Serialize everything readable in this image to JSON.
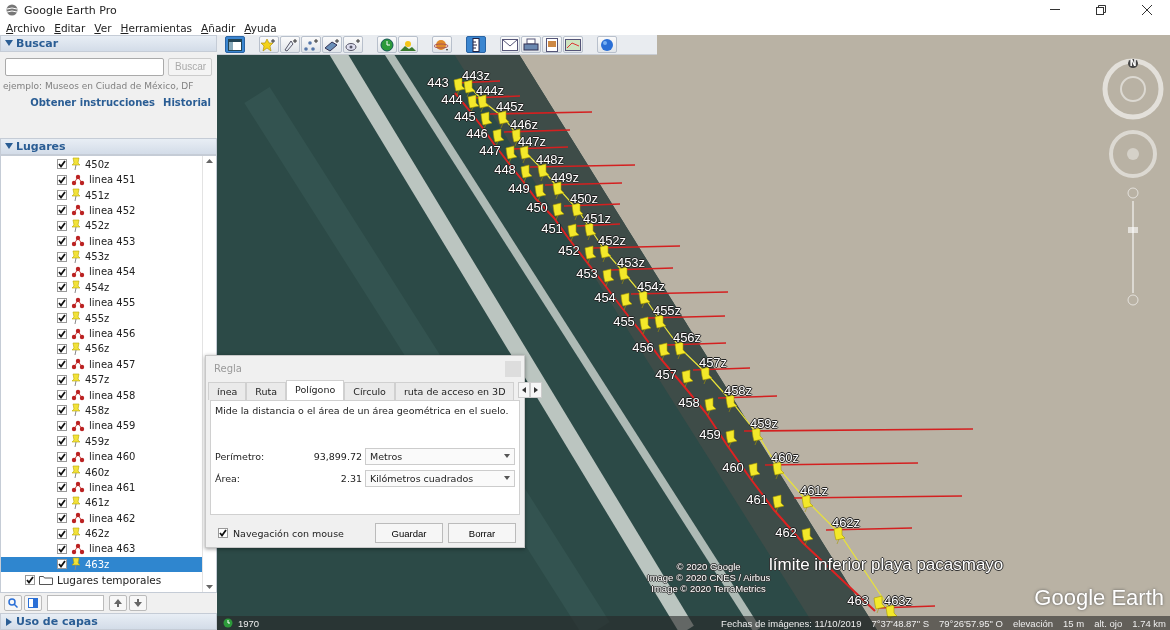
{
  "window": {
    "title": "Google Earth Pro"
  },
  "menu": [
    {
      "label": "Archivo"
    },
    {
      "label": "Editar"
    },
    {
      "label": "Ver"
    },
    {
      "label": "Herramientas"
    },
    {
      "label": "Añadir"
    },
    {
      "label": "Ayuda"
    }
  ],
  "search": {
    "title": "Buscar",
    "expanded": true,
    "button": "Buscar",
    "hint": "ejemplo: Museos en Ciudad de México, DF",
    "links": [
      "Obtener instrucciones",
      "Historial"
    ]
  },
  "places": {
    "title": "Lugares",
    "expanded": true,
    "items": [
      {
        "label": "450z",
        "kind": "placemark",
        "checked": true,
        "selected": false
      },
      {
        "label": "linea 451",
        "kind": "path",
        "checked": true,
        "selected": false
      },
      {
        "label": "451z",
        "kind": "placemark",
        "checked": true,
        "selected": false
      },
      {
        "label": "linea 452",
        "kind": "path",
        "checked": true,
        "selected": false
      },
      {
        "label": "452z",
        "kind": "placemark",
        "checked": true,
        "selected": false
      },
      {
        "label": "linea 453",
        "kind": "path",
        "checked": true,
        "selected": false
      },
      {
        "label": "453z",
        "kind": "placemark",
        "checked": true,
        "selected": false
      },
      {
        "label": "linea 454",
        "kind": "path",
        "checked": true,
        "selected": false
      },
      {
        "label": "454z",
        "kind": "placemark",
        "checked": true,
        "selected": false
      },
      {
        "label": "linea 455",
        "kind": "path",
        "checked": true,
        "selected": false
      },
      {
        "label": "455z",
        "kind": "placemark",
        "checked": true,
        "selected": false
      },
      {
        "label": "linea 456",
        "kind": "path",
        "checked": true,
        "selected": false
      },
      {
        "label": "456z",
        "kind": "placemark",
        "checked": true,
        "selected": false
      },
      {
        "label": "linea 457",
        "kind": "path",
        "checked": true,
        "selected": false
      },
      {
        "label": "457z",
        "kind": "placemark",
        "checked": true,
        "selected": false
      },
      {
        "label": "linea 458",
        "kind": "path",
        "checked": true,
        "selected": false
      },
      {
        "label": "458z",
        "kind": "placemark",
        "checked": true,
        "selected": false
      },
      {
        "label": "linea 459",
        "kind": "path",
        "checked": true,
        "selected": false
      },
      {
        "label": "459z",
        "kind": "placemark",
        "checked": true,
        "selected": false
      },
      {
        "label": "linea 460",
        "kind": "path",
        "checked": true,
        "selected": false
      },
      {
        "label": "460z",
        "kind": "placemark",
        "checked": true,
        "selected": false
      },
      {
        "label": "linea 461",
        "kind": "path",
        "checked": true,
        "selected": false
      },
      {
        "label": "461z",
        "kind": "placemark",
        "checked": true,
        "selected": false
      },
      {
        "label": "linea 462",
        "kind": "path",
        "checked": true,
        "selected": false
      },
      {
        "label": "462z",
        "kind": "placemark",
        "checked": true,
        "selected": false
      },
      {
        "label": "linea 463",
        "kind": "path",
        "checked": true,
        "selected": false
      },
      {
        "label": "463z",
        "kind": "placemark",
        "checked": true,
        "selected": true
      }
    ],
    "temporary": {
      "label": "Lugares temporales",
      "checked": true
    }
  },
  "layers": {
    "title": "Uso de capas",
    "expanded": false
  },
  "toolbar_groups": [
    {
      "items": [
        {
          "kind": "sidebar",
          "selected": true
        }
      ]
    },
    {
      "items": [
        {
          "kind": "placemark",
          "selected": false
        },
        {
          "kind": "polygon",
          "selected": false
        },
        {
          "kind": "path",
          "selected": false
        },
        {
          "kind": "overlay",
          "selected": false
        },
        {
          "kind": "tour",
          "selected": false
        }
      ]
    },
    {
      "items": [
        {
          "kind": "history",
          "selected": false
        },
        {
          "kind": "sun",
          "selected": false
        }
      ]
    },
    {
      "items": [
        {
          "kind": "planets",
          "selected": false
        }
      ]
    },
    {
      "items": [
        {
          "kind": "ruler",
          "selected": true
        }
      ]
    },
    {
      "items": [
        {
          "kind": "email",
          "selected": false
        },
        {
          "kind": "print",
          "selected": false
        },
        {
          "kind": "image",
          "selected": false
        },
        {
          "kind": "maps",
          "selected": false
        }
      ]
    },
    {
      "items": [
        {
          "kind": "earth",
          "selected": false
        }
      ]
    }
  ],
  "ruler_dialog": {
    "title": "Regla",
    "tabs": [
      {
        "label": "ínea",
        "selected": false
      },
      {
        "label": "Ruta",
        "selected": false
      },
      {
        "label": "Polígono",
        "selected": true
      },
      {
        "label": "Círculo",
        "selected": false
      },
      {
        "label": "ruta de acceso en 3D",
        "selected": false
      }
    ],
    "description": "Mide la distancia o el área de un área geométrica en el suelo.",
    "measurements": [
      {
        "label": "Perímetro:",
        "value": "93,899.72",
        "unit": "Metros"
      },
      {
        "label": "Área:",
        "value": "2.31",
        "unit": "Kilómetros cuadrados"
      }
    ],
    "mouse_navigation": {
      "label": "Navegación con mouse",
      "checked": true
    },
    "buttons": [
      "Guardar",
      "Borrar"
    ]
  },
  "map": {
    "markers": [
      {
        "number": "443",
        "z": "443z"
      },
      {
        "number": "444",
        "z": "444z"
      },
      {
        "number": "445",
        "z": "445z"
      },
      {
        "number": "446",
        "z": "446z"
      },
      {
        "number": "447",
        "z": "447z"
      },
      {
        "number": "448",
        "z": "448z"
      },
      {
        "number": "449",
        "z": "449z"
      },
      {
        "number": "450",
        "z": "450z"
      },
      {
        "number": "451",
        "z": "451z"
      },
      {
        "number": "452",
        "z": "452z"
      },
      {
        "number": "453",
        "z": "453z"
      },
      {
        "number": "454",
        "z": "454z"
      },
      {
        "number": "455",
        "z": "455z"
      },
      {
        "number": "456",
        "z": "456z"
      },
      {
        "number": "457",
        "z": "457z"
      },
      {
        "number": "458",
        "z": "458z"
      },
      {
        "number": "459",
        "z": "459z"
      },
      {
        "number": "460",
        "z": "460z"
      },
      {
        "number": "461",
        "z": "461z"
      },
      {
        "number": "462",
        "z": "462z"
      },
      {
        "number": "463",
        "z": "463z"
      }
    ],
    "place_label": "límite inferior playa pacasmayo",
    "attribution": [
      "© 2020 Google",
      "Image © 2020 CNES / Airbus",
      "Image © 2020 TerraMetrics"
    ],
    "logo": "Google Earth",
    "compass_north": "N"
  },
  "status_bar": {
    "year": "1970",
    "imagery_date": "Fechas de imágenes: 11/10/2019",
    "latitude": "7°37'48.87\" S",
    "longitude": "79°26'57.95\" O",
    "elevation_label": "elevación",
    "elevation": "15 m",
    "eye_label": "alt. ojo",
    "eye_altitude": "1.74 km"
  }
}
